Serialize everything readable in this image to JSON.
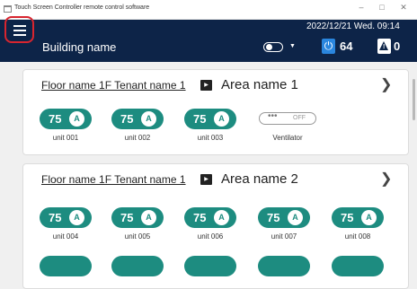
{
  "window": {
    "title": "Touch Screen Controller remote control software",
    "minimize": "–",
    "maximize": "□",
    "close": "✕"
  },
  "header": {
    "building_name": "Building name",
    "datetime": "2022/12/21 Wed. 09:14",
    "power_count": "64",
    "warning_count": "0"
  },
  "areas": [
    {
      "floor": "Floor name 1F Tenant name 1",
      "area": "Area name 1",
      "units": [
        {
          "temp": "75",
          "mode": "A",
          "name": "unit 001"
        },
        {
          "temp": "75",
          "mode": "A",
          "name": "unit 002"
        },
        {
          "temp": "75",
          "mode": "A",
          "name": "unit 003"
        }
      ],
      "ventilator": {
        "dots": "•••",
        "state": "OFF",
        "name": "Ventilator"
      }
    },
    {
      "floor": "Floor name 1F Tenant name 1",
      "area": "Area name 2",
      "units": [
        {
          "temp": "75",
          "mode": "A",
          "name": "unit 004"
        },
        {
          "temp": "75",
          "mode": "A",
          "name": "unit 005"
        },
        {
          "temp": "75",
          "mode": "A",
          "name": "unit 006"
        },
        {
          "temp": "75",
          "mode": "A",
          "name": "unit 007"
        },
        {
          "temp": "75",
          "mode": "A",
          "name": "unit 008"
        }
      ]
    }
  ],
  "colors": {
    "header_bg": "#0d2448",
    "unit_pill": "#1d8c80",
    "power_badge": "#2a86de",
    "menu_highlight": "#d8252f"
  }
}
